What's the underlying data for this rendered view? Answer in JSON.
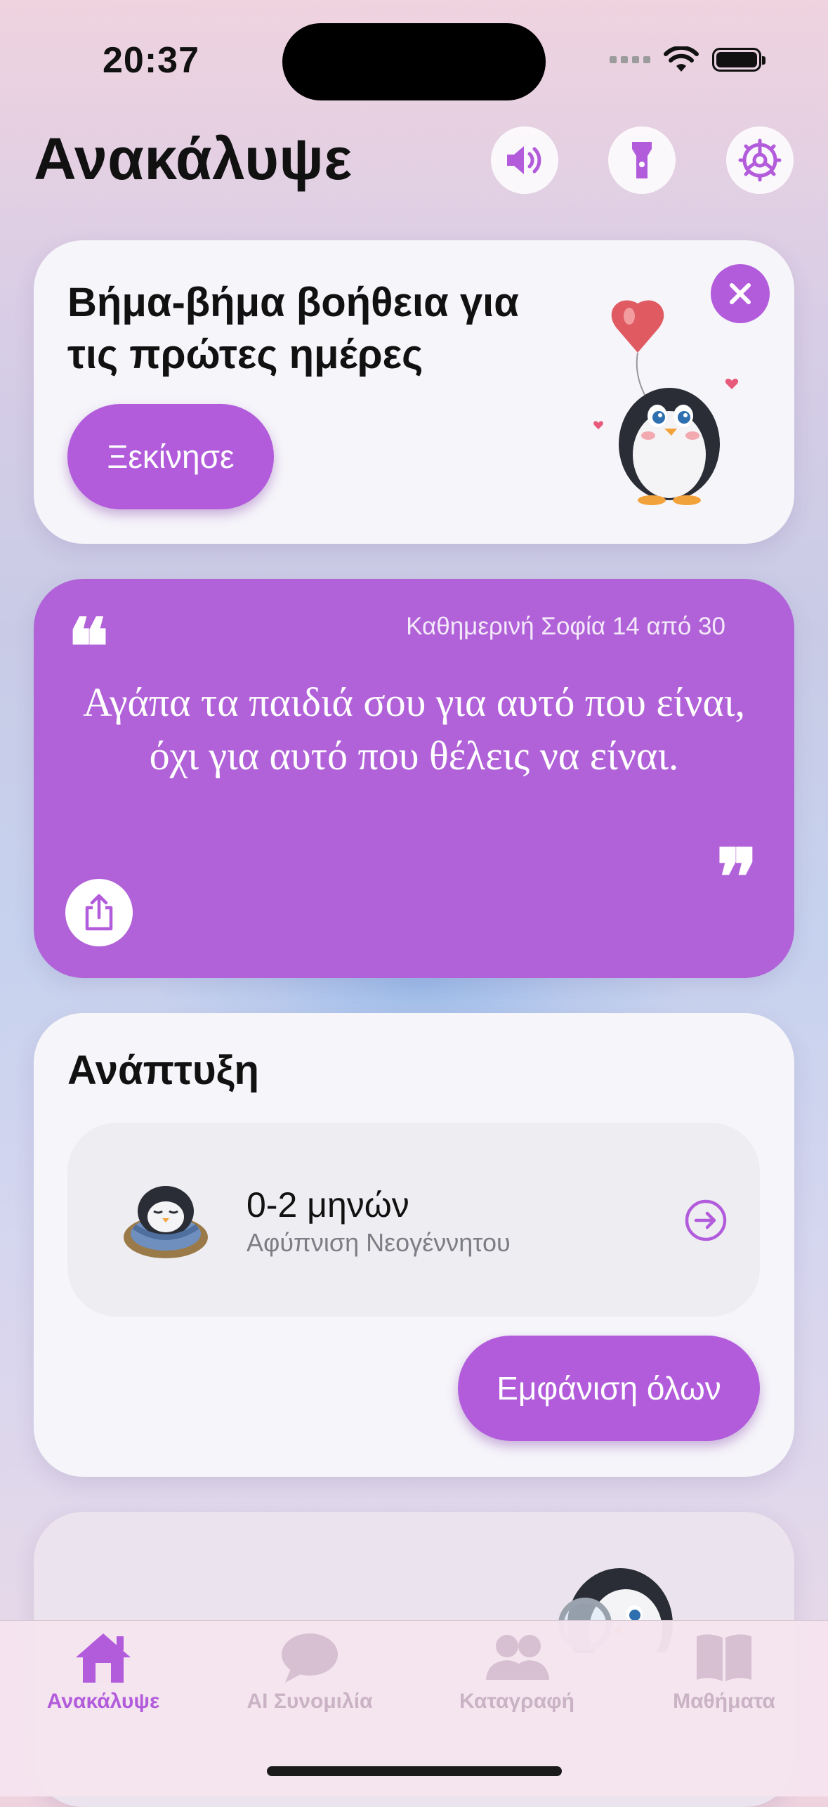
{
  "status_bar": {
    "time": "20:37"
  },
  "header": {
    "title": "Ανακάλυψε"
  },
  "onboarding_card": {
    "title": "Βήμα-βήμα βοήθεια για τις πρώτες ημέρες",
    "start_label": "Ξεκίνησε"
  },
  "quote_card": {
    "meta": "Καθημερινή Σοφία 14 από 30",
    "text": "Αγάπα τα παιδιά σου για αυτό που είναι, όχι για αυτό που θέλεις να είναι.",
    "open_mark": "❝",
    "close_mark": "❞"
  },
  "growth_card": {
    "title": "Ανάπτυξη",
    "age_item": {
      "label": "0-2 μηνών",
      "subtitle": "Αφύπνιση Νεογέννητου"
    },
    "show_all_label": "Εμφάνιση όλων"
  },
  "tab_bar": {
    "tabs": [
      {
        "label": "Ανακάλυψε",
        "icon": "house-icon",
        "active": true
      },
      {
        "label": "AI Συνομιλία",
        "icon": "chat-bubble-icon",
        "active": false
      },
      {
        "label": "Καταγραφή",
        "icon": "people-icon",
        "active": false
      },
      {
        "label": "Μαθήματα",
        "icon": "book-icon",
        "active": false
      }
    ]
  },
  "colors": {
    "accent": "#b25cdc",
    "quote_bg": "#b162d8",
    "card_bg": "#f6f5fa",
    "inactive_tab": "#c9b3c4"
  }
}
